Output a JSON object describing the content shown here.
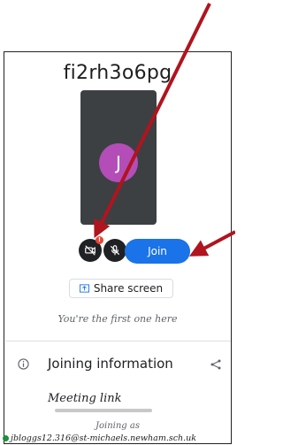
{
  "meeting": {
    "code": "fi2rh3o6pg",
    "avatar_initial": "J"
  },
  "controls": {
    "camera_badge": "!",
    "join_label": "Join"
  },
  "share": {
    "label": "Share screen"
  },
  "status": {
    "first_one_text": "You're the first one here"
  },
  "info": {
    "label": "Joining information",
    "meeting_link_label": "Meeting link"
  },
  "account": {
    "joining_as_label": "Joining as",
    "email": "jbloggs12.316@st-michaels.newham.sch.uk"
  },
  "colors": {
    "join_blue": "#1a73e8",
    "avatar_purple": "#b44db7",
    "arrow_red": "#b0141e",
    "preview_bg": "#3c4043"
  },
  "icons": [
    "camera-off-icon",
    "mic-off-icon",
    "present-screen-icon",
    "info-icon",
    "share-icon"
  ]
}
